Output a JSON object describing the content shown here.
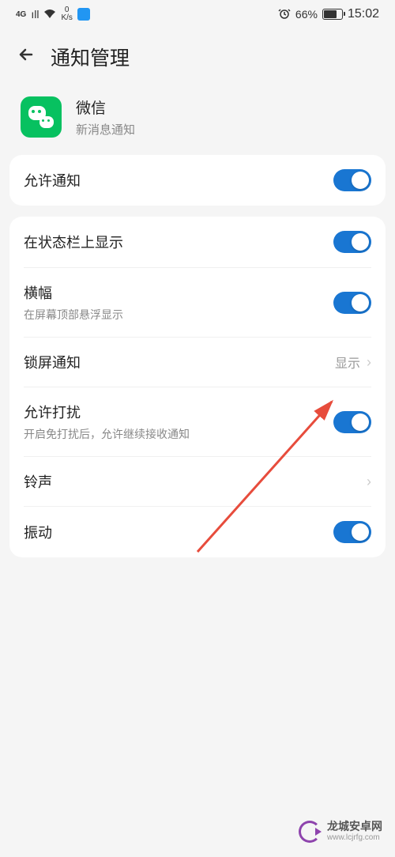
{
  "status_bar": {
    "network_type": "4G",
    "speed_value": "0",
    "speed_unit": "K/s",
    "battery_percent": "66%",
    "time": "15:02"
  },
  "header": {
    "title": "通知管理"
  },
  "app": {
    "name": "微信",
    "subtitle": "新消息通知"
  },
  "settings": {
    "allow_notifications": {
      "title": "允许通知"
    },
    "status_bar_display": {
      "title": "在状态栏上显示"
    },
    "banner": {
      "title": "横幅",
      "subtitle": "在屏幕顶部悬浮显示"
    },
    "lock_screen": {
      "title": "锁屏通知",
      "value": "显示"
    },
    "allow_disturb": {
      "title": "允许打扰",
      "subtitle": "开启免打扰后，允许继续接收通知"
    },
    "ringtone": {
      "title": "铃声"
    },
    "vibration": {
      "title": "振动"
    }
  },
  "watermark": {
    "title": "龙城安卓网",
    "url": "www.lcjrfg.com"
  }
}
